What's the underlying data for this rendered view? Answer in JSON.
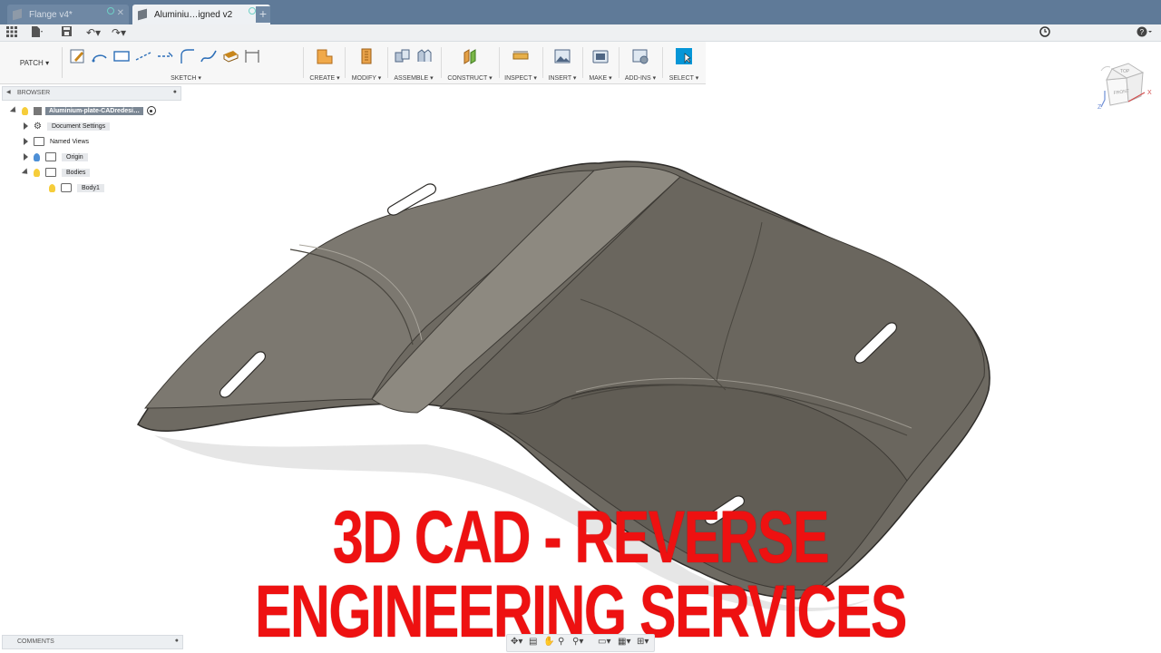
{
  "tabs": [
    {
      "label": "Flange v4*",
      "active": false
    },
    {
      "label": "Aluminiu…igned v2",
      "active": true
    }
  ],
  "ribbon": {
    "workspace": "PATCH",
    "groups": [
      "SKETCH",
      "CREATE",
      "MODIFY",
      "ASSEMBLE",
      "CONSTRUCT",
      "INSPECT",
      "INSERT",
      "MAKE",
      "ADD-INS",
      "SELECT"
    ]
  },
  "browser": {
    "title": "BROWSER",
    "root": "Aluminium-plate-CADredesi…",
    "items": [
      "Document Settings",
      "Named Views",
      "Origin",
      "Bodies",
      "Body1"
    ]
  },
  "viewcube": {
    "top": "TOP",
    "front": "FRONT",
    "z": "Z",
    "x": "X"
  },
  "comments": {
    "title": "COMMENTS"
  },
  "caption": "3D CAD - REVERSE ENGINEERING SERVICES",
  "colors": {
    "accent": "#0696d7",
    "caption": "#ee1111",
    "titlebar": "#5f7a98"
  }
}
